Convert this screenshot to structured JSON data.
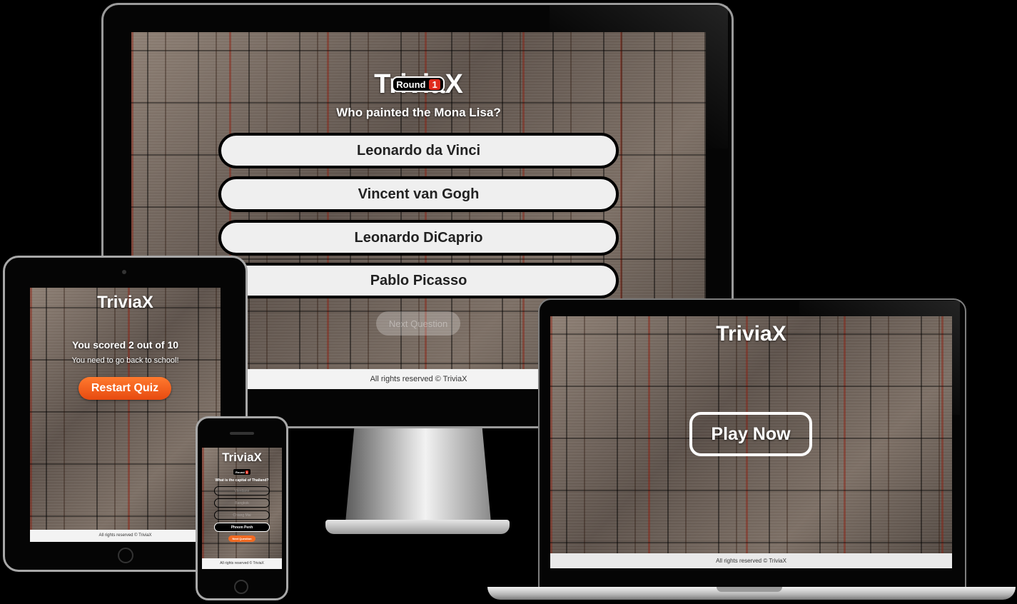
{
  "brand": {
    "logo_main": "Trivia",
    "logo_x": "X"
  },
  "desktop": {
    "round_label": "Round",
    "round_number": "1",
    "question": "Who painted the Mona Lisa?",
    "answers": [
      "Leonardo da Vinci",
      "Vincent van Gogh",
      "Leonardo DiCaprio",
      "Pablo Picasso"
    ],
    "next_label": "Next Question",
    "footer": "All rights reserved © TriviaX"
  },
  "tablet": {
    "score_text": "You scored 2 out of 10",
    "message": "You need to go back to school!",
    "restart_label": "Restart Quiz",
    "footer": "All rights reserved © TriviaX"
  },
  "phone": {
    "round_label": "Round",
    "round_number": "1",
    "question": "What is the capital of Thailand?",
    "answers": [
      "Vientiane",
      "Bangkok",
      "Chiang Mai",
      "Phnom Penh"
    ],
    "next_label": "Next Question",
    "footer": "All rights reserved © TriviaX"
  },
  "laptop": {
    "play_label": "Play Now",
    "footer": "All rights reserved © TriviaX"
  },
  "colors": {
    "accent_orange": "#f06a23",
    "badge_red": "#e02b1d"
  }
}
